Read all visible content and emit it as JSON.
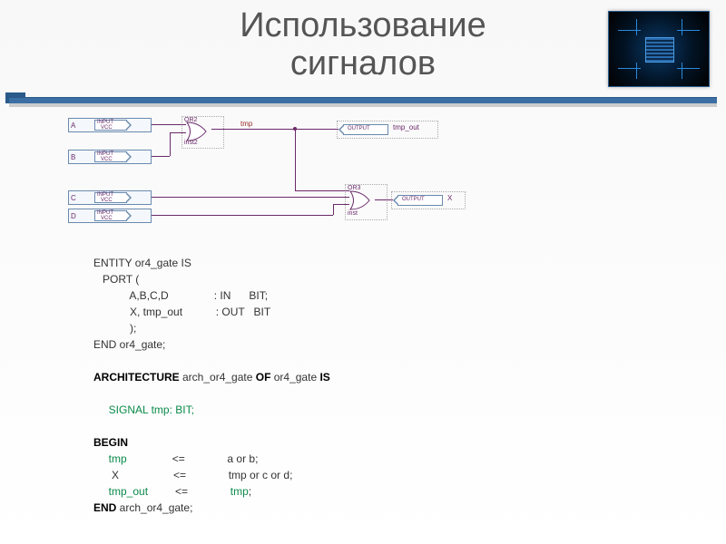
{
  "title_line1": "Использование",
  "title_line2": "сигналов",
  "schematic": {
    "inputs": [
      "A",
      "B",
      "C",
      "D"
    ],
    "pin_type_label": "INPUT",
    "pin_sub_label": "VCC",
    "gate1": {
      "name": "OR2",
      "inst": "inst2"
    },
    "gate2": {
      "name": "OR3",
      "inst": "inst"
    },
    "net_tmp": "tmp",
    "out1_type": "OUTPUT",
    "out1_label": "tmp_out",
    "out2_type": "OUTPUT",
    "out2_label": "X"
  },
  "code": {
    "l1": "ENTITY or4_gate IS",
    "l2": "   PORT (",
    "l3": "            A,B,C,D               : IN      BIT;",
    "l4": "            X, tmp_out           : OUT   BIT",
    "l5": "            );",
    "l6": "END or4_gate;",
    "l7_a": "ARCHITECTURE",
    "l7_b": " arch_or4_gate ",
    "l7_c": "OF",
    "l7_d": " or4_gate ",
    "l7_e": "IS",
    "l8_a": "     SIGNAL",
    "l8_b": " tmp: BIT;",
    "l9": "BEGIN",
    "l10_a": "     tmp",
    "l10_b": "               <=              a or b;",
    "l11": "      X                  <=              tmp or c or d;",
    "l12_a": "     tmp_out",
    "l12_b": "         <=              ",
    "l12_c": "tmp",
    "l12_d": ";",
    "l13_a": "END",
    "l13_b": " arch_or4_gate;"
  }
}
